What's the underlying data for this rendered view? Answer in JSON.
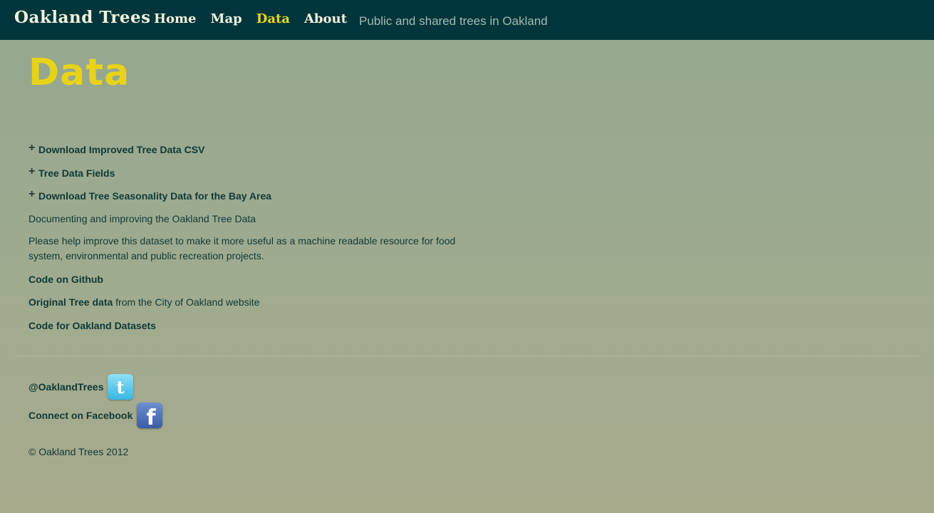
{
  "navbar": {
    "brand": "Oakland Trees",
    "items": [
      {
        "label": "Home",
        "active": false
      },
      {
        "label": "Map",
        "active": false
      },
      {
        "label": "Data",
        "active": true
      },
      {
        "label": "About",
        "active": false
      }
    ],
    "tagline": "Public and shared trees in Oakland"
  },
  "page": {
    "title": "Data"
  },
  "sections": [
    {
      "label": "Download Improved Tree Data CSV",
      "icon": "plus-icon"
    },
    {
      "label": "Tree Data Fields",
      "icon": "plus-icon"
    },
    {
      "label": "Download Tree Seasonality Data for the Bay Area",
      "icon": "plus-icon"
    }
  ],
  "body": {
    "intro": "Documenting and improving the Oakland Tree Data",
    "help": "Please help improve this dataset to make it more useful as a machine readable resource for food system, environmental and public recreation projects.",
    "github_link": "Code on Github",
    "original_link": "Original Tree data",
    "original_suffix": " from the City of Oakland website",
    "datasets_link": "Code for Oakland Datasets"
  },
  "footer": {
    "twitter": "@OaklandTrees",
    "facebook": "Connect on Facebook",
    "copyright": "© Oakland Trees 2012"
  },
  "colors": {
    "navbar_bg": "#00363b",
    "accent_yellow": "#e8d318",
    "text_dark": "#0f3a38",
    "twitter_blue": "#38b6e2",
    "facebook_blue": "#3b5ca8"
  }
}
